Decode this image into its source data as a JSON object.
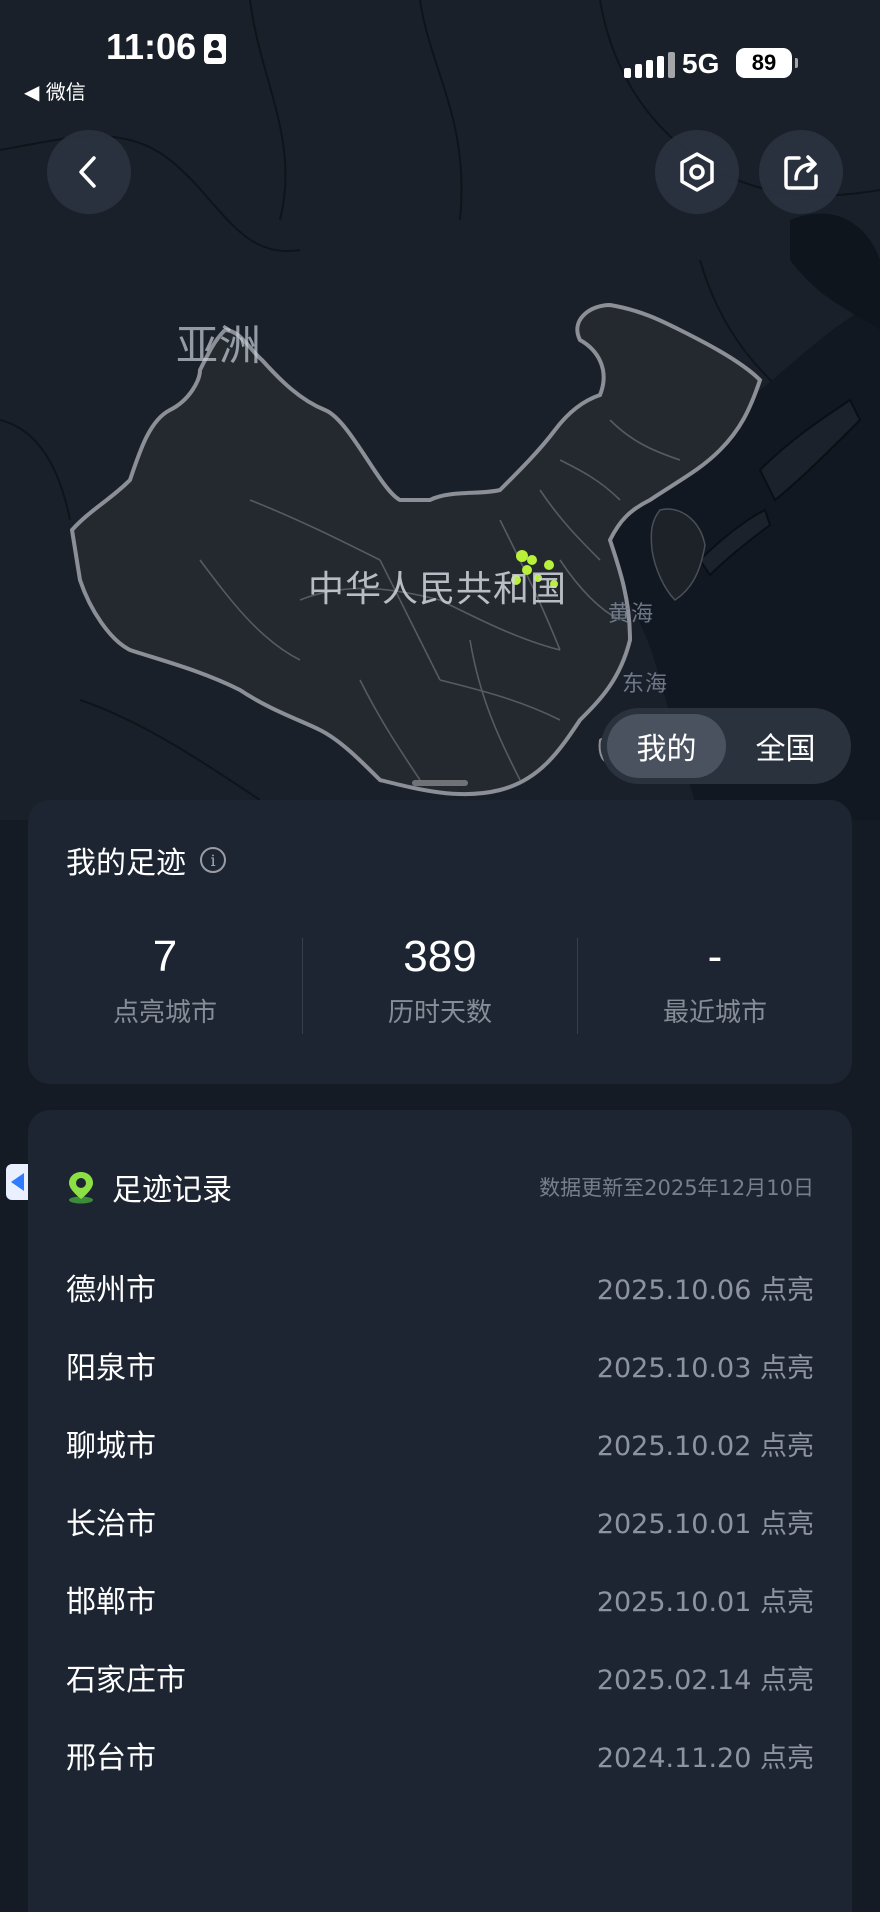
{
  "status_bar": {
    "time": "11:06",
    "back_app": "◀ 微信",
    "network": "5G",
    "battery": "89"
  },
  "map": {
    "continent_label": "亚洲",
    "country_label": "中华人民共和国",
    "sea_labels": [
      "黄海",
      "东海"
    ]
  },
  "toolbar": {
    "back_icon": "chevron-left-icon",
    "settings_icon": "hexagon-settings-icon",
    "share_icon": "share-icon"
  },
  "toggle": {
    "options": [
      "我的",
      "全国"
    ],
    "selected": "我的"
  },
  "stats": {
    "title": "我的足迹",
    "items": [
      {
        "value": "7",
        "label": "点亮城市"
      },
      {
        "value": "389",
        "label": "历时天数"
      },
      {
        "value": "-",
        "label": "最近城市"
      }
    ]
  },
  "records": {
    "title": "足迹记录",
    "updated": "数据更新至2025年12月10日",
    "items": [
      {
        "city": "德州市",
        "date": "2025.10.06 点亮"
      },
      {
        "city": "阳泉市",
        "date": "2025.10.03 点亮"
      },
      {
        "city": "聊城市",
        "date": "2025.10.02 点亮"
      },
      {
        "city": "长治市",
        "date": "2025.10.01 点亮"
      },
      {
        "city": "邯郸市",
        "date": "2025.10.01 点亮"
      },
      {
        "city": "石家庄市",
        "date": "2025.02.14 点亮"
      },
      {
        "city": "邢台市",
        "date": "2024.11.20 点亮"
      }
    ]
  },
  "colors": {
    "background": "#151b24",
    "card": "#1d2532",
    "highlight": "#b8f03a",
    "border": "#8c8f96"
  }
}
